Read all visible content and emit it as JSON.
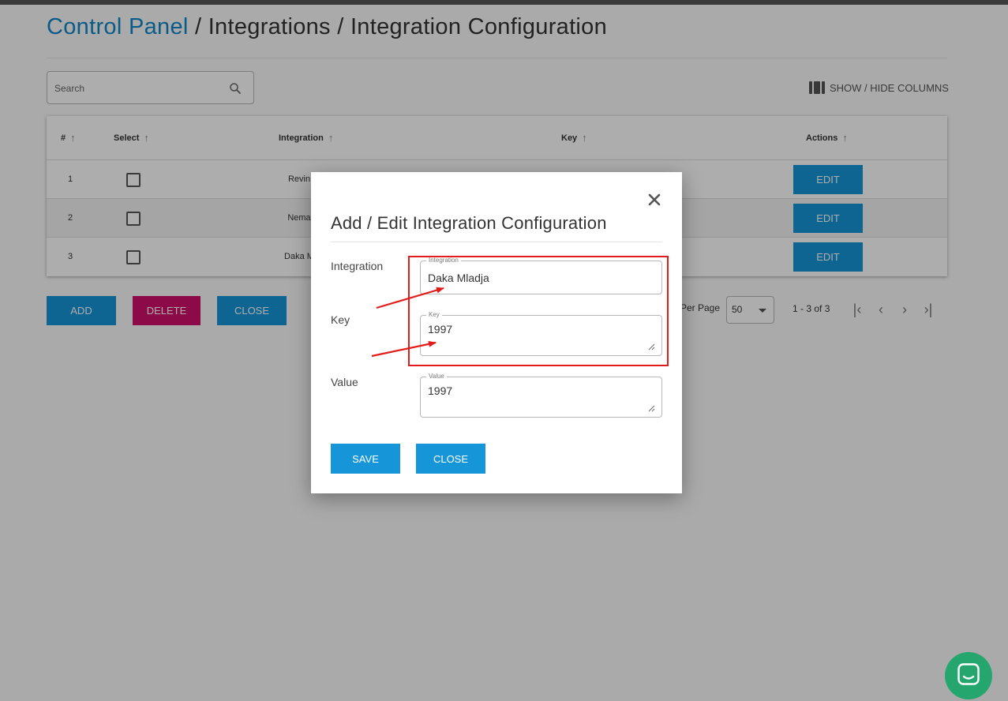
{
  "breadcrumb": {
    "root": "Control Panel",
    "separator": " / ",
    "section": "Integrations",
    "current": "Integration Configuration"
  },
  "toolbar": {
    "search_placeholder": "Search",
    "show_hide_columns": "SHOW / HIDE COLUMNS"
  },
  "table": {
    "headers": {
      "number": "#",
      "select": "Select",
      "integration": "Integration",
      "key": "Key",
      "actions": "Actions"
    },
    "rows": [
      {
        "number": "1",
        "integration": "Revin",
        "edit_label": "EDIT"
      },
      {
        "number": "2",
        "integration": "Nema",
        "edit_label": "EDIT"
      },
      {
        "number": "3",
        "integration": "Daka M",
        "edit_label": "EDIT"
      }
    ]
  },
  "actions": {
    "add_label": "ADD",
    "delete_label": "DELETE",
    "close_label": "CLOSE"
  },
  "pagination": {
    "per_page_label": "Per Page",
    "per_page_value": "50",
    "range": "1 - 3 of 3"
  },
  "modal": {
    "title": "Add / Edit Integration Configuration",
    "fields": {
      "integration": {
        "label": "Integration",
        "legend": "Integration",
        "value": "Daka Mladja"
      },
      "key": {
        "label": "Key",
        "legend": "Key",
        "value": "1997"
      },
      "value": {
        "label": "Value",
        "legend": "Value",
        "value": "1997"
      }
    },
    "save_label": "SAVE",
    "close_label": "CLOSE"
  },
  "colors": {
    "accent": "#1696d8",
    "danger": "#d0106a",
    "link": "#1187c9",
    "annotation": "#e21b1b",
    "chat": "#26a66f"
  }
}
